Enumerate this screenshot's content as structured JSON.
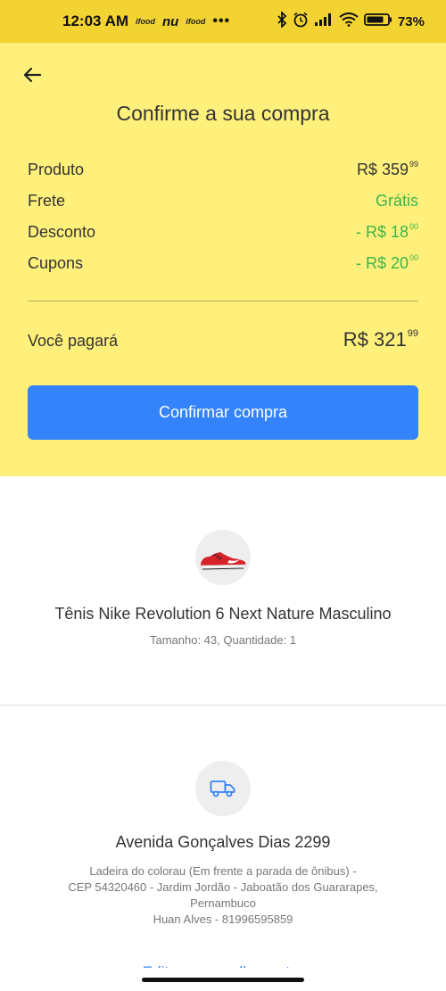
{
  "status_bar": {
    "time": "12:03 AM",
    "logo_ifood_1": "ifood",
    "logo_nu": "nu",
    "logo_ifood_2": "ifood",
    "more": "•••",
    "battery_percent": "73%",
    "icons": [
      "bluetooth-icon",
      "alarm-icon",
      "signal-icon",
      "wifi-icon",
      "battery-icon"
    ]
  },
  "header": {
    "title": "Confirme a sua compra"
  },
  "summary": {
    "product_label": "Produto",
    "product_price_main": "R$ 359",
    "product_price_cents": "99",
    "shipping_label": "Frete",
    "shipping_value": "Grátis",
    "discount_label": "Desconto",
    "discount_main": "- R$ 18",
    "discount_cents": "00",
    "coupons_label": "Cupons",
    "coupons_main": "- R$ 20",
    "coupons_cents": "00",
    "total_label": "Você pagará",
    "total_main": "R$ 321",
    "total_cents": "99"
  },
  "confirm_button": "Confirmar compra",
  "product": {
    "name": "Tênis Nike Revolution 6 Next Nature Masculino",
    "meta": "Tamanho: 43, Quantidade: 1"
  },
  "shipping": {
    "street": "Avenida Gonçalves Dias 2299",
    "line1": "Ladeira do colorau (Em frente a parada de ônibus) -",
    "line2": "CEP 54320460 - Jardim Jordão - Jaboatão dos Guararapes,",
    "line3": "Pernambuco",
    "line4": "Huan Alves - 81996595859",
    "edit_link": "Editar ou escolher outro"
  },
  "colors": {
    "status_bar": "#f2d332",
    "header_bg": "#fff07c",
    "accent_blue": "#3483fa",
    "green": "#3bb54a"
  }
}
